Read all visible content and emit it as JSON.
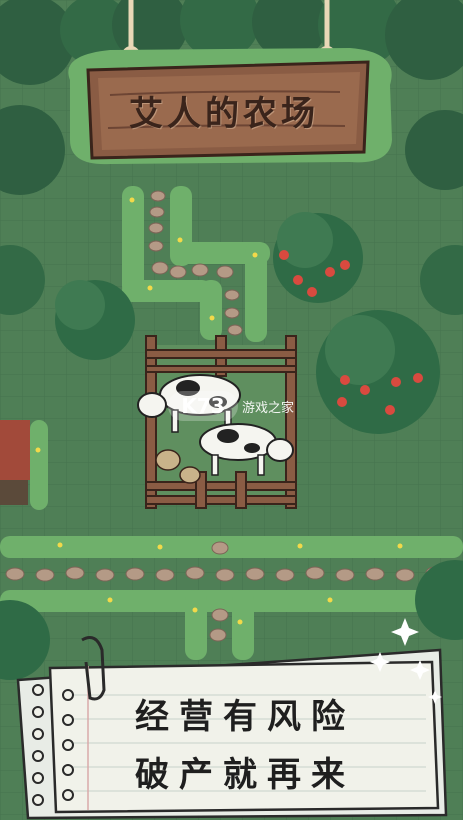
{
  "sign": {
    "title": "艾人的农场"
  },
  "note": {
    "line1": "经营有风险",
    "line2": "破产就再来"
  },
  "watermark": {
    "badge": "K73",
    "text": "游戏之家"
  },
  "colors": {
    "grass": "#4f7f56",
    "tree": "#3f7a52",
    "wood": "#8a5c44",
    "paper": "#f1f2ea",
    "path_stone": "#b49a86"
  }
}
